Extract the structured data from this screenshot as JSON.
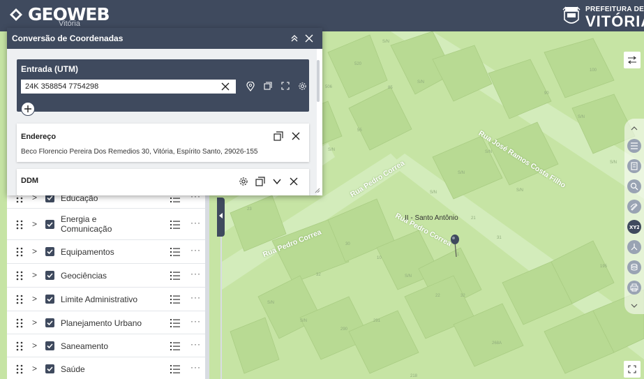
{
  "header": {
    "logo_text": "GEOWEB",
    "logo_sub": "Vitória",
    "prefeitura_line1": "PREFEITURA DE",
    "prefeitura_line2": "VITÓRIA"
  },
  "dialog": {
    "title": "Conversão de Coordenadas",
    "input_card": {
      "title": "Entrada (UTM)",
      "value": "24K 358854 7754298"
    },
    "results": [
      {
        "title": "Endereço",
        "value": "Beco Florencio Pereira Dos Remedios 30, Vitória, Espírito Santo, 29026-155"
      },
      {
        "title": "DDM",
        "value": ""
      }
    ]
  },
  "layers": [
    {
      "label": "Educação"
    },
    {
      "label": "Energia e Comunicação"
    },
    {
      "label": "Equipamentos"
    },
    {
      "label": "Geociências"
    },
    {
      "label": "Limite Administrativo"
    },
    {
      "label": "Planejamento Urbano"
    },
    {
      "label": "Saneamento"
    },
    {
      "label": "Saúde"
    }
  ],
  "map": {
    "roads": [
      "Rua José Ramos Costa Filho",
      "Rua Pedro Correa",
      "Rua Pedro Correa",
      "Rua Pedro Correa"
    ],
    "place": "II - Santo Antônio",
    "lots": [
      "S/N",
      "520",
      "506",
      "85",
      "55",
      "S/N",
      "S/N",
      "100",
      "90",
      "S/N",
      "S/N",
      "S/N",
      "S/N",
      "S/N",
      "S/N",
      "23",
      "30",
      "10",
      "32",
      "S/N",
      "22",
      "291",
      "290",
      "32",
      "268A",
      "195",
      "31",
      "21",
      "218",
      "S/N",
      "S/N",
      "1"
    ]
  },
  "toolbar": {
    "icons": [
      "layers-icon",
      "legend-icon",
      "search-coordinates-icon",
      "draw-icon",
      "xyz-icon",
      "share-icon",
      "data-icon",
      "print-icon"
    ]
  },
  "colors": {
    "header": "#3f4a5e",
    "map_base": "#c9e6a8",
    "map_block": "#b9dc92",
    "road": "#d7eec0"
  }
}
